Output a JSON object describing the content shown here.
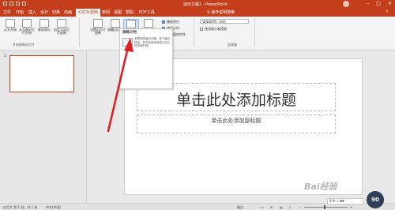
{
  "window": {
    "title": "演示文稿1 - PowerPoint"
  },
  "tabs": [
    {
      "label": "文件"
    },
    {
      "label": "开始"
    },
    {
      "label": "插入"
    },
    {
      "label": "设计"
    },
    {
      "label": "切换"
    },
    {
      "label": "动画"
    },
    {
      "label": "幻灯片放映"
    },
    {
      "label": "审阅"
    },
    {
      "label": "视图"
    },
    {
      "label": "帮助"
    },
    {
      "label": "PDF工具"
    }
  ],
  "tell_me": "♀ 操作说明搜索",
  "ribbon": {
    "buttons": [
      {
        "label": "从头开始"
      },
      {
        "label": "从当前幻灯片开始"
      },
      {
        "label": "联机演示"
      },
      {
        "label": "自定义幻灯片放映"
      },
      {
        "label": "设置幻灯片放映"
      },
      {
        "label": "隐藏幻灯片"
      },
      {
        "label": "排练计时"
      },
      {
        "label": "录制幻灯片演示"
      }
    ],
    "groups": [
      {
        "label": "开始放映幻灯片"
      },
      {
        "label": "设置"
      },
      {
        "label": "监视器"
      }
    ],
    "checkboxes": [
      {
        "label": "播放旁白",
        "checked": true
      },
      {
        "label": "使用计时",
        "checked": true
      },
      {
        "label": "显示媒体控件",
        "checked": true
      },
      {
        "label": "使用演示者视图",
        "checked": false
      }
    ],
    "monitor_label": "监视器(M): 自动"
  },
  "tooltip": {
    "title": "排练计时",
    "text": "全屏放映演示文稿，练习演示时间，并自动保存每张幻灯片的放映时间。"
  },
  "slide_pane": {
    "number": "1"
  },
  "slide": {
    "title_placeholder": "单击此处添加标题",
    "subtitle_placeholder": "单击此处添加副标题"
  },
  "statusbar": {
    "slide_info": "幻灯片 第 1 张，共 1 张",
    "language": "中文(中国)",
    "notes": "备注",
    "zoom": "63%"
  },
  "watermark": "Bai经验",
  "badge": "90",
  "colors": {
    "accent": "#c43e1c",
    "arrow": "#e02020"
  }
}
